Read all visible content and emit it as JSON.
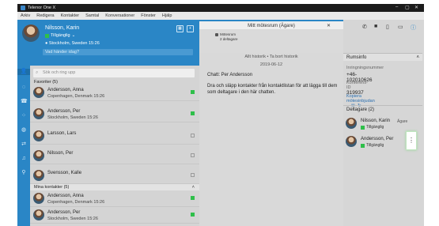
{
  "window": {
    "title": "Telenor One X"
  },
  "menu": [
    "Arkiv",
    "Redigera",
    "Kontakter",
    "Samtal",
    "Konversationer",
    "Fönster",
    "Hjälp"
  ],
  "profile": {
    "name": "Nilsson, Karin",
    "status": "Tillgänglig",
    "location": "Stockholm, Sweden 15:26",
    "mood_placeholder": "Vad händer idag?"
  },
  "contacts": {
    "search_placeholder": "Sök och ring upp",
    "favorites_header": "Favoriter (5)",
    "favorites": [
      {
        "name": "Andersson, Anna",
        "sub": "Copenhagen, Denmark 15:26",
        "online": true
      },
      {
        "name": "Andersson, Per",
        "sub": "Stockholm, Sweden 15:26",
        "online": true
      },
      {
        "name": "Larsson, Lars",
        "sub": "",
        "online": false
      },
      {
        "name": "Nilsson, Per",
        "sub": "",
        "online": false
      },
      {
        "name": "Svensson, Kalle",
        "sub": "",
        "online": false
      }
    ],
    "my_contacts_header": "Mina kontakter (5)",
    "my_contacts": [
      {
        "name": "Andersson, Anna",
        "sub": "Copenhagen, Denmark 15:26",
        "online": true
      },
      {
        "name": "Andersson, Per",
        "sub": "Stockholm, Sweden 15:26",
        "online": true
      }
    ]
  },
  "chat": {
    "tab_title": "Mitt mötesrum (Ägare)",
    "room_small": "Mötesrum",
    "participants_small": "2 deltagare",
    "history_links": "Allt historik  •  Ta bort historik",
    "date": "2019-06-12",
    "message_title": "Chatt: Per Andersson",
    "message_body": "Dra och släpp kontakter från kontaktlistan för att lägga till dem som deltagare i den här chatten."
  },
  "room_info": {
    "header": "Rumsinfo",
    "dial_label": "Inringningsnummer",
    "dial_number": "+46-102010626",
    "conference_label": "Konferens-ID",
    "conference_id": "319937",
    "copy_link": "Kopiera mötesinbjudan",
    "participants_header": "Deltagare (2)"
  },
  "participants": [
    {
      "name": "Nilsson, Karin",
      "status": "Tillgänglig",
      "role": "Ägare"
    },
    {
      "name": "Andersson, Per",
      "status": "Tillgänglig",
      "role": ""
    }
  ]
}
